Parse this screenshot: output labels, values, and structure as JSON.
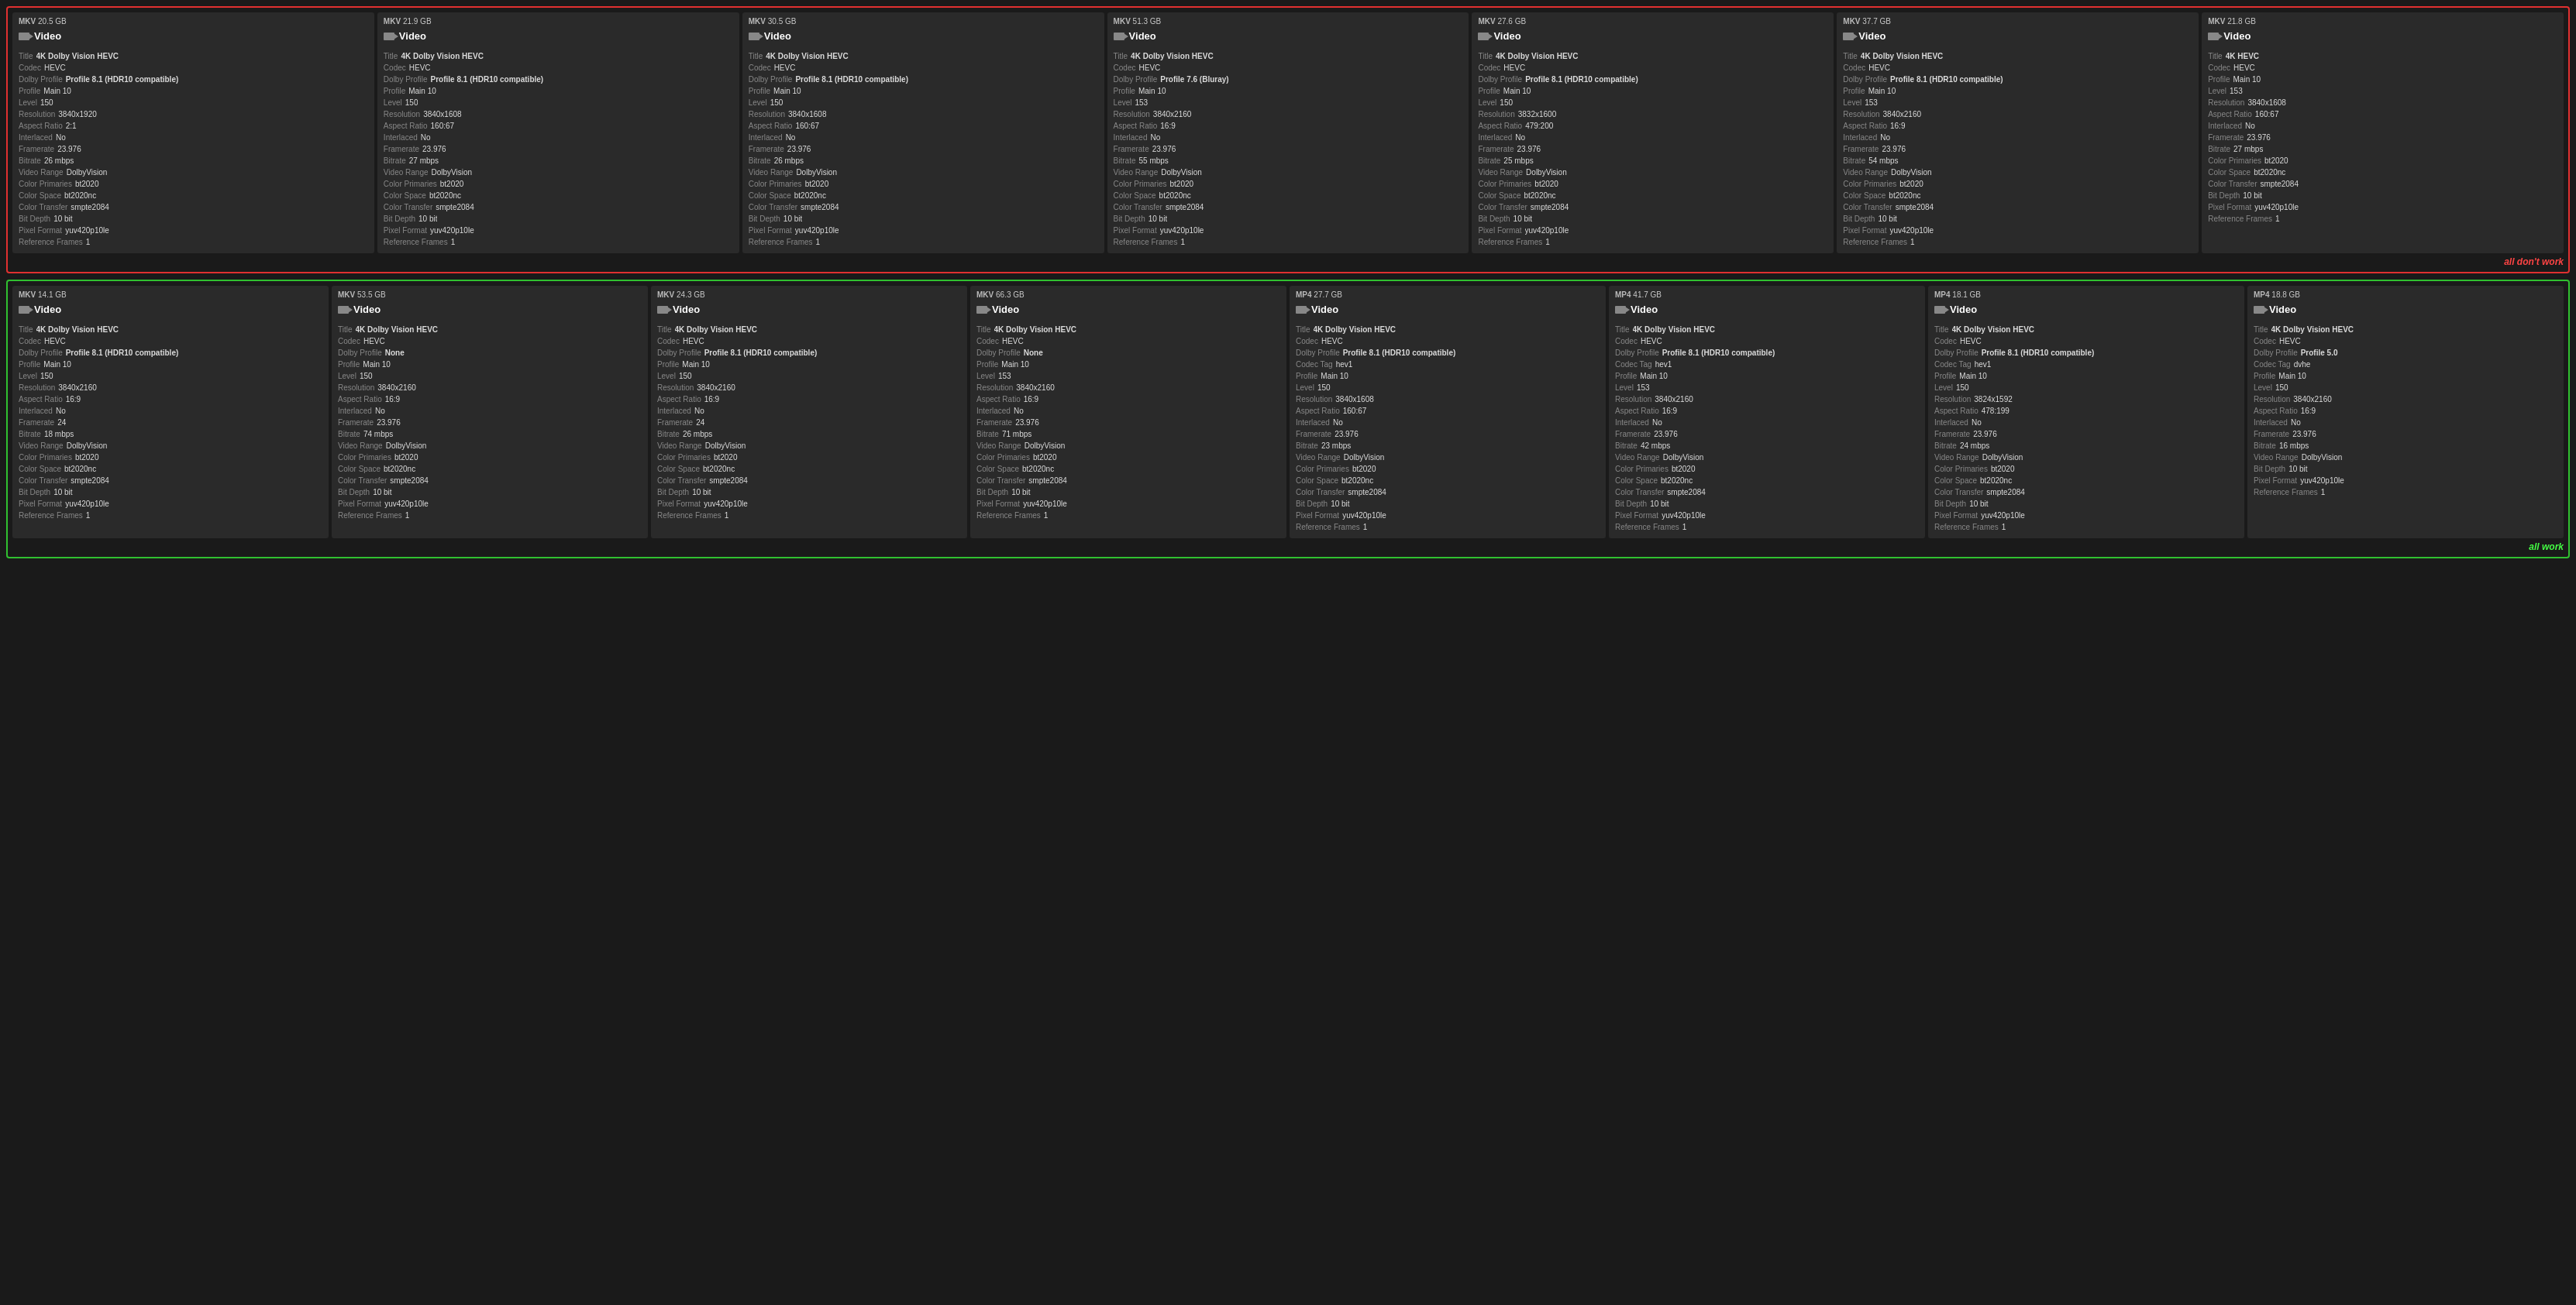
{
  "sections": [
    {
      "id": "top-section",
      "status": "all don't work",
      "status_color": "red",
      "cards": [
        {
          "format": "MKV",
          "size": "20.5 GB",
          "title": "4K Dolby Vision HEVC",
          "codec": "HEVC",
          "dolby_profile": "Profile 8.1 (HDR10 compatible)",
          "profile": "Main 10",
          "level": "150",
          "resolution": "3840x1920",
          "aspect_ratio": "2:1",
          "interlaced": "No",
          "framerate": "23.976",
          "bitrate": "26 mbps",
          "video_range": "DolbyVision",
          "color_primaries": "bt2020",
          "color_space": "bt2020nc",
          "color_transfer": "smpte2084",
          "bit_depth": "10 bit",
          "pixel_format": "yuv420p10le",
          "reference_frames": "1"
        },
        {
          "format": "MKV",
          "size": "21.9 GB",
          "title": "4K Dolby Vision HEVC",
          "codec": "HEVC",
          "dolby_profile": "Profile 8.1 (HDR10 compatible)",
          "profile": "Main 10",
          "level": "150",
          "resolution": "3840x1608",
          "aspect_ratio": "160:67",
          "interlaced": "No",
          "framerate": "23.976",
          "bitrate": "27 mbps",
          "video_range": "DolbyVision",
          "color_primaries": "bt2020",
          "color_space": "bt2020nc",
          "color_transfer": "smpte2084",
          "bit_depth": "10 bit",
          "pixel_format": "yuv420p10le",
          "reference_frames": "1"
        },
        {
          "format": "MKV",
          "size": "30.5 GB",
          "title": "4K Dolby Vision HEVC",
          "codec": "HEVC",
          "dolby_profile": "Profile 8.1 (HDR10 compatible)",
          "profile": "Main 10",
          "level": "150",
          "resolution": "3840x1608",
          "aspect_ratio": "160:67",
          "interlaced": "No",
          "framerate": "23.976",
          "bitrate": "26 mbps",
          "video_range": "DolbyVision",
          "color_primaries": "bt2020",
          "color_space": "bt2020nc",
          "color_transfer": "smpte2084",
          "bit_depth": "10 bit",
          "pixel_format": "yuv420p10le",
          "reference_frames": "1"
        },
        {
          "format": "MKV",
          "size": "51.3 GB",
          "title": "4K Dolby Vision HEVC",
          "codec": "HEVC",
          "dolby_profile": "Profile 7.6 (Bluray)",
          "profile": "Main 10",
          "level": "153",
          "resolution": "3840x2160",
          "aspect_ratio": "16:9",
          "interlaced": "No",
          "framerate": "23.976",
          "bitrate": "55 mbps",
          "video_range": "DolbyVision",
          "color_primaries": "bt2020",
          "color_space": "bt2020nc",
          "color_transfer": "smpte2084",
          "bit_depth": "10 bit",
          "pixel_format": "yuv420p10le",
          "reference_frames": "1"
        },
        {
          "format": "MKV",
          "size": "27.6 GB",
          "title": "4K Dolby Vision HEVC",
          "codec": "HEVC",
          "dolby_profile": "Profile 8.1 (HDR10 compatible)",
          "profile": "Main 10",
          "level": "150",
          "resolution": "3832x1600",
          "aspect_ratio": "479:200",
          "interlaced": "No",
          "framerate": "23.976",
          "bitrate": "25 mbps",
          "video_range": "DolbyVision",
          "color_primaries": "bt2020",
          "color_space": "bt2020nc",
          "color_transfer": "smpte2084",
          "bit_depth": "10 bit",
          "pixel_format": "yuv420p10le",
          "reference_frames": "1"
        },
        {
          "format": "MKV",
          "size": "37.7 GB",
          "title": "4K Dolby Vision HEVC",
          "codec": "HEVC",
          "dolby_profile": "Profile 8.1 (HDR10 compatible)",
          "profile": "Main 10",
          "level": "153",
          "resolution": "3840x2160",
          "aspect_ratio": "16:9",
          "interlaced": "No",
          "framerate": "23.976",
          "bitrate": "54 mbps",
          "video_range": "DolbyVision",
          "color_primaries": "bt2020",
          "color_space": "bt2020nc",
          "color_transfer": "smpte2084",
          "bit_depth": "10 bit",
          "pixel_format": "yuv420p10le",
          "reference_frames": "1"
        },
        {
          "format": "MKV",
          "size": "21.8 GB",
          "title": "4K HEVC",
          "codec": "HEVC",
          "dolby_profile": null,
          "profile": "Main 10",
          "level": "153",
          "resolution": "3840x1608",
          "aspect_ratio": "160:67",
          "interlaced": "No",
          "framerate": "23.976",
          "bitrate": "27 mbps",
          "video_range": null,
          "color_primaries": "bt2020",
          "color_space": "bt2020nc",
          "color_transfer": "smpte2084",
          "bit_depth": "10 bit",
          "pixel_format": "yuv420p10le",
          "reference_frames": "1"
        }
      ]
    },
    {
      "id": "bottom-section",
      "status": "all work",
      "status_color": "green",
      "cards": [
        {
          "format": "MKV",
          "size": "14.1 GB",
          "title": "4K Dolby Vision HEVC",
          "codec": "HEVC",
          "dolby_profile": "Profile 8.1 (HDR10 compatible)",
          "profile": "Main 10",
          "level": "150",
          "resolution": "3840x2160",
          "aspect_ratio": "16:9",
          "interlaced": "No",
          "framerate": "24",
          "bitrate": "18 mbps",
          "video_range": "DolbyVision",
          "color_primaries": "bt2020",
          "color_space": "bt2020nc",
          "color_transfer": "smpte2084",
          "bit_depth": "10 bit",
          "pixel_format": "yuv420p10le",
          "reference_frames": "1"
        },
        {
          "format": "MKV",
          "size": "53.5 GB",
          "title": "4K Dolby Vision HEVC",
          "codec": "HEVC",
          "dolby_profile": "None",
          "profile": "Main 10",
          "level": "150",
          "resolution": "3840x2160",
          "aspect_ratio": "16:9",
          "interlaced": "No",
          "framerate": "23.976",
          "bitrate": "74 mbps",
          "video_range": "DolbyVision",
          "color_primaries": "bt2020",
          "color_space": "bt2020nc",
          "color_transfer": "smpte2084",
          "bit_depth": "10 bit",
          "pixel_format": "yuv420p10le",
          "reference_frames": "1"
        },
        {
          "format": "MKV",
          "size": "24.3 GB",
          "title": "4K Dolby Vision HEVC",
          "codec": "HEVC",
          "dolby_profile": "Profile 8.1 (HDR10 compatible)",
          "profile": "Main 10",
          "level": "150",
          "resolution": "3840x2160",
          "aspect_ratio": "16:9",
          "interlaced": "No",
          "framerate": "24",
          "bitrate": "26 mbps",
          "video_range": "DolbyVision",
          "color_primaries": "bt2020",
          "color_space": "bt2020nc",
          "color_transfer": "smpte2084",
          "bit_depth": "10 bit",
          "pixel_format": "yuv420p10le",
          "reference_frames": "1"
        },
        {
          "format": "MKV",
          "size": "66.3 GB",
          "title": "4K Dolby Vision HEVC",
          "codec": "HEVC",
          "dolby_profile": "None",
          "profile": "Main 10",
          "level": "153",
          "resolution": "3840x2160",
          "aspect_ratio": "16:9",
          "interlaced": "No",
          "framerate": "23.976",
          "bitrate": "71 mbps",
          "video_range": "DolbyVision",
          "color_primaries": "bt2020",
          "color_space": "bt2020nc",
          "color_transfer": "smpte2084",
          "bit_depth": "10 bit",
          "pixel_format": "yuv420p10le",
          "reference_frames": "1"
        },
        {
          "format": "MP4",
          "size": "27.7 GB",
          "title": "4K Dolby Vision HEVC",
          "codec": "HEVC",
          "dolby_profile": "Profile 8.1 (HDR10 compatible)",
          "codec_tag": "hev1",
          "profile": "Main 10",
          "level": "150",
          "resolution": "3840x1608",
          "aspect_ratio": "160:67",
          "interlaced": "No",
          "framerate": "23.976",
          "bitrate": "23 mbps",
          "video_range": "DolbyVision",
          "color_primaries": "bt2020",
          "color_space": "bt2020nc",
          "color_transfer": "smpte2084",
          "bit_depth": "10 bit",
          "pixel_format": "yuv420p10le",
          "reference_frames": "1"
        },
        {
          "format": "MP4",
          "size": "41.7 GB",
          "title": "4K Dolby Vision HEVC",
          "codec": "HEVC",
          "dolby_profile": "Profile 8.1 (HDR10 compatible)",
          "codec_tag": "hev1",
          "profile": "Main 10",
          "level": "153",
          "resolution": "3840x2160",
          "aspect_ratio": "16:9",
          "interlaced": "No",
          "framerate": "23.976",
          "bitrate": "42 mbps",
          "video_range": "DolbyVision",
          "color_primaries": "bt2020",
          "color_space": "bt2020nc",
          "color_transfer": "smpte2084",
          "bit_depth": "10 bit",
          "pixel_format": "yuv420p10le",
          "reference_frames": "1"
        },
        {
          "format": "MP4",
          "size": "18.1 GB",
          "title": "4K Dolby Vision HEVC",
          "codec": "HEVC",
          "dolby_profile": "Profile 8.1 (HDR10 compatible)",
          "codec_tag": "hev1",
          "profile": "Main 10",
          "level": "150",
          "resolution": "3824x1592",
          "aspect_ratio": "478:199",
          "interlaced": "No",
          "framerate": "23.976",
          "bitrate": "24 mbps",
          "video_range": "DolbyVision",
          "color_primaries": "bt2020",
          "color_space": "bt2020nc",
          "color_transfer": "smpte2084",
          "bit_depth": "10 bit",
          "pixel_format": "yuv420p10le",
          "reference_frames": "1"
        },
        {
          "format": "MP4",
          "size": "18.8 GB",
          "title": "4K Dolby Vision HEVC",
          "codec": "HEVC",
          "dolby_profile": "Profile 5.0",
          "codec_tag": "dvhe",
          "profile": "Main 10",
          "level": "150",
          "resolution": "3840x2160",
          "aspect_ratio": "16:9",
          "interlaced": "No",
          "framerate": "23.976",
          "bitrate": "16 mbps",
          "video_range": "DolbyVision",
          "color_primaries": null,
          "color_space": null,
          "color_transfer": null,
          "bit_depth": "10 bit",
          "pixel_format": "yuv420p10le",
          "reference_frames": "1"
        }
      ]
    }
  ],
  "labels": {
    "video_section": "Video",
    "title_label": "Title",
    "codec_label": "Codec",
    "dolby_profile_label": "Dolby Profile",
    "codec_tag_label": "Codec Tag",
    "profile_label": "Profile",
    "level_label": "Level",
    "resolution_label": "Resolution",
    "aspect_ratio_label": "Aspect Ratio",
    "interlaced_label": "Interlaced",
    "framerate_label": "Framerate",
    "bitrate_label": "Bitrate",
    "video_range_label": "Video Range",
    "color_primaries_label": "Color Primaries",
    "color_space_label": "Color Space",
    "color_transfer_label": "Color Transfer",
    "bit_depth_label": "Bit Depth",
    "pixel_format_label": "Pixel Format",
    "reference_frames_label": "Reference Frames"
  }
}
